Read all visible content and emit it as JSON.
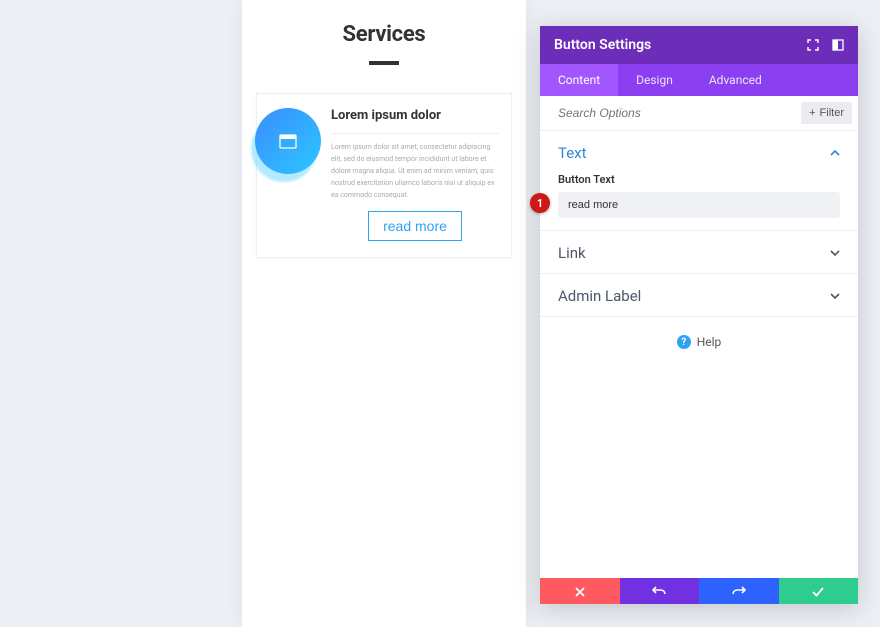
{
  "preview": {
    "heading": "Services",
    "card": {
      "title": "Lorem ipsum dolor",
      "body": "Lorem ipsum dolor sit amet, consectetur adipiscing elit, sed do eiusmod tempor incididunt ut labore et dolore magna aliqua. Ut enim ad minim veniam, quis nostrud exercitation ullamco laboris nisi ut aliquip ex ea commodo consequat.",
      "button_label": "read more"
    }
  },
  "panel": {
    "title": "Button Settings",
    "tabs": {
      "content": "Content",
      "design": "Design",
      "advanced": "Advanced"
    },
    "search_placeholder": "Search Options",
    "filter_label": "Filter",
    "sections": {
      "text": "Text",
      "link": "Link",
      "admin_label": "Admin Label"
    },
    "fields": {
      "button_text_label": "Button Text",
      "button_text_value": "read more"
    },
    "step_badge": "1",
    "help_label": "Help"
  }
}
